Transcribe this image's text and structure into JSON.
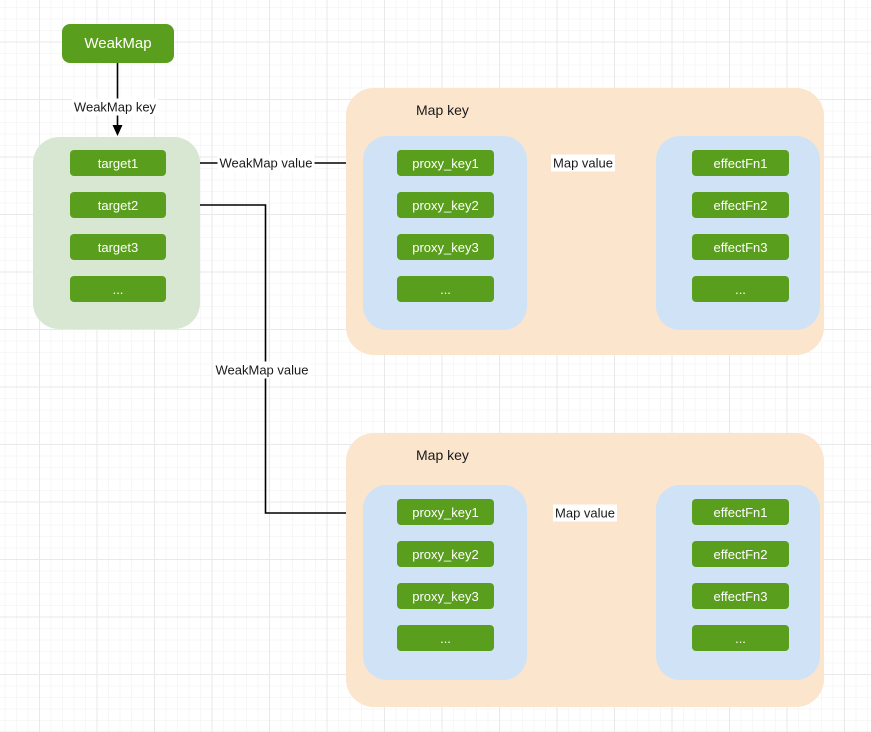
{
  "diagram": {
    "weakmap": {
      "label": "WeakMap"
    },
    "targets": {
      "items": [
        "target1",
        "target2",
        "target3",
        "..."
      ]
    },
    "edge_labels": {
      "weakmap_key": "WeakMap key",
      "weakmap_value_top": "WeakMap value",
      "weakmap_value_bottom": "WeakMap value",
      "map_value_top": "Map value",
      "map_value_bottom": "Map value"
    },
    "maps": [
      {
        "title": "Map key",
        "proxy_keys": [
          "proxy_key1",
          "proxy_key2",
          "proxy_key3",
          "..."
        ],
        "effect_fns": [
          "effectFn1",
          "effectFn2",
          "effectFn3",
          "..."
        ]
      },
      {
        "title": "Map key",
        "proxy_keys": [
          "proxy_key1",
          "proxy_key2",
          "proxy_key3",
          "..."
        ],
        "effect_fns": [
          "effectFn1",
          "effectFn2",
          "effectFn3",
          "..."
        ]
      }
    ],
    "colors": {
      "node_green": "#5a9e1d",
      "container_green": "#d7e7d2",
      "container_orange": "#fbe5cd",
      "container_blue": "#d0e2f6",
      "edge_black": "#000000"
    }
  }
}
